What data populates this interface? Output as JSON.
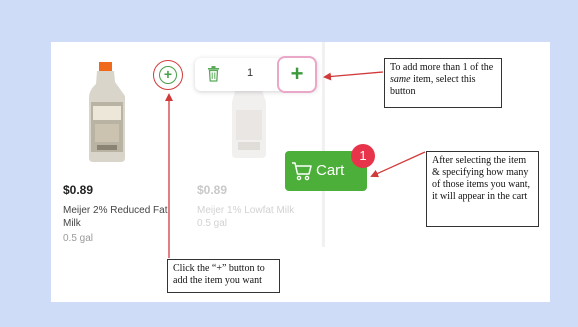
{
  "products": [
    {
      "price": "$0.89",
      "name": "Meijer 2% Reduced Fat Milk",
      "unit": "0.5 gal"
    },
    {
      "price": "$0.89",
      "name": "Meijer 1% Lowfat Milk",
      "unit": "0.5 gal"
    }
  ],
  "quantity_selector": {
    "quantity": "1"
  },
  "cart": {
    "label": "Cart",
    "badge_count": "1"
  },
  "callouts": {
    "more_items_before": "To add more than 1 of the ",
    "more_items_emphasis": "same",
    "more_items_after": " item, select this button",
    "cart_note": "After selecting the item & specifying how many of those items you want, it will appear in the cart",
    "add_note": "Click the “+” button to add the item you want"
  },
  "colors": {
    "background": "#cfdcf7",
    "annotation_red": "#d23a3a",
    "cart_green": "#4caf39",
    "badge_red": "#e8344b"
  },
  "icons": [
    "plus-circle-icon",
    "trash-icon",
    "plus-icon",
    "cart-icon"
  ]
}
